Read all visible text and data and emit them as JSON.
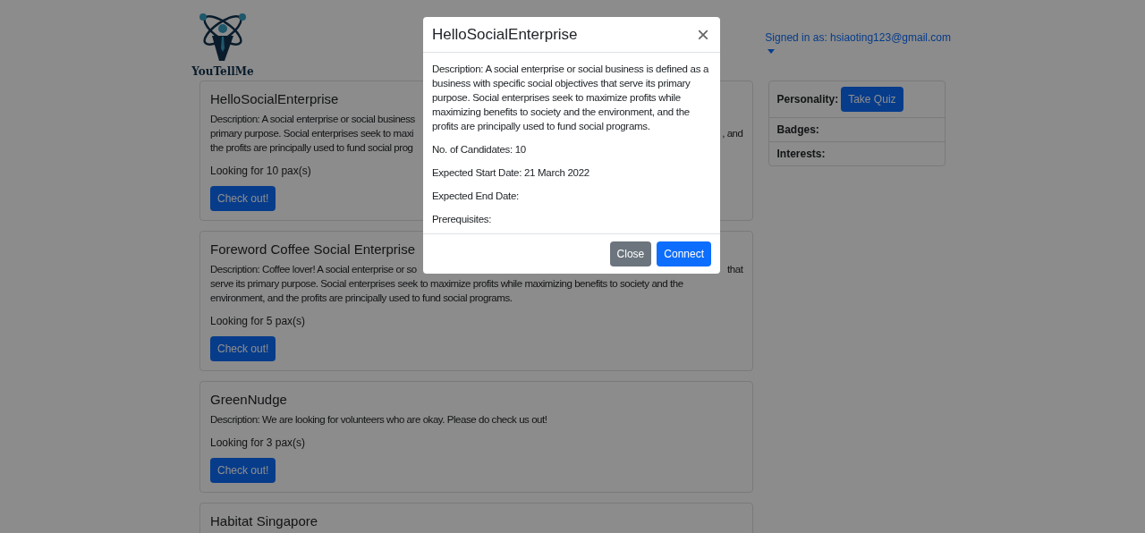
{
  "header": {
    "logo_text": "YouTellMe",
    "signed_in": "Signed in as: hsiaoting123@gmail.com"
  },
  "cards": [
    {
      "title": "HelloSocialEnterprise",
      "description_lines": [
        {
          "left": "Description: A social enterprise or social business"
        },
        {
          "left": "primary purpose. Social enterprises seek to maxi",
          "right": ", and"
        },
        {
          "left": "the profits are principally used to fund social prog"
        }
      ],
      "looking_for": "Looking for 10 pax(s)",
      "button": "Check out!"
    },
    {
      "title": "Foreword Coffee Social Enterprise",
      "description_lines": [
        {
          "left": "Description: Coffee lover! A social enterprise or so",
          "right": "that"
        },
        {
          "left": "serve its primary purpose. Social enterprises seek to maximize profits while maximizing benefits to society and the"
        },
        {
          "left": "environment, and the profits are principally used to fund social programs."
        }
      ],
      "looking_for": "Looking for 5 pax(s)",
      "button": "Check out!"
    },
    {
      "title": "GreenNudge",
      "description_lines": [
        {
          "left": "Description: We are looking for volunteers who are okay. Please do check us out!"
        }
      ],
      "looking_for": "Looking for 3 pax(s)",
      "button": "Check out!"
    },
    {
      "title": "Habitat Singapore"
    }
  ],
  "profile": [
    {
      "label": "Personality:",
      "button": "Take Quiz"
    },
    {
      "label": "Badges:"
    },
    {
      "label": "Interests:"
    }
  ],
  "modal": {
    "title": "HelloSocialEnterprise",
    "close_icon": "×",
    "fields": [
      "Description: A social enterprise or social business is defined as a business with specific social objectives that serve its primary purpose. Social enterprises seek to maximize profits while maximizing benefits to society and the environment, and the profits are principally used to fund social programs.",
      "No. of Candidates: 10",
      "Expected Start Date: 21 March 2022",
      "Expected End Date:",
      "Prerequisites:"
    ],
    "buttons": [
      {
        "label": "Close",
        "kind": "secondary"
      },
      {
        "label": "Connect",
        "kind": "primary"
      }
    ]
  }
}
